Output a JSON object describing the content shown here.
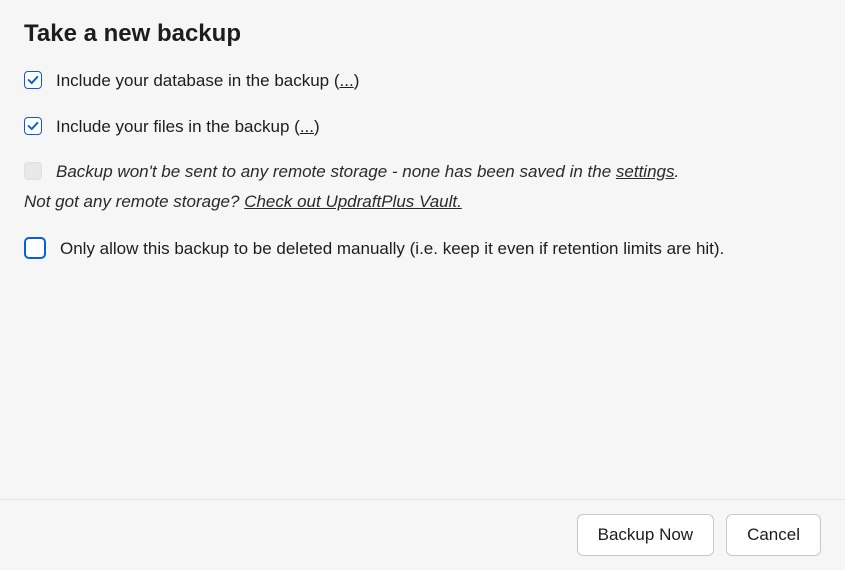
{
  "title": "Take a new backup",
  "options": {
    "include_db": {
      "label_pre": "Include your database in the backup (",
      "dots": "...",
      "label_post": ")",
      "checked": true
    },
    "include_files": {
      "label_pre": "Include your files in the backup (",
      "dots": "...",
      "label_post": ")",
      "checked": true
    },
    "remote_storage": {
      "line1_pre": "Backup won't be sent to any remote storage - none has been saved in the ",
      "settings_link": "settings",
      "line1_post": ".",
      "line2_pre": "Not got any remote storage? ",
      "vault_link": "Check out UpdraftPlus Vault.",
      "checked": false
    },
    "manual_delete": {
      "label": "Only allow this backup to be deleted manually (i.e. keep it even if retention limits are hit).",
      "checked": false
    }
  },
  "buttons": {
    "backup_now": "Backup Now",
    "cancel": "Cancel"
  }
}
